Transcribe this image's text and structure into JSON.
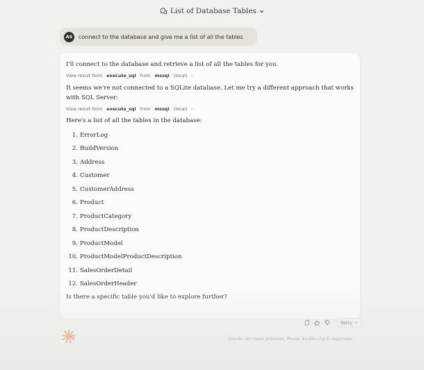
{
  "header": {
    "title": "List of Database Tables"
  },
  "user_message": {
    "initials": "AS",
    "text": "connect to the database and give me a list of all the tables"
  },
  "assistant": {
    "intro": "I'll connect to the database and retrieve a list of all the tables for you.",
    "tool_calls": [
      {
        "prefix": "View result from",
        "tool": "execute_sql",
        "from_label": "from",
        "server": "mssql",
        "scope": "(local)"
      },
      {
        "prefix": "View result from",
        "tool": "execute_sql",
        "from_label": "from",
        "server": "mssql",
        "scope": "(local)"
      }
    ],
    "middle": "It seems we're not connected to a SQLite database. Let me try a different approach that works with SQL Server:",
    "list_intro": "Here's a list of all the tables in the database:",
    "tables": [
      {
        "num": "1.",
        "name": "ErrorLog"
      },
      {
        "num": "2.",
        "name": "BuildVersion"
      },
      {
        "num": "3.",
        "name": "Address"
      },
      {
        "num": "4.",
        "name": "Customer"
      },
      {
        "num": "5.",
        "name": "CustomerAddress"
      },
      {
        "num": "6.",
        "name": "Product"
      },
      {
        "num": "7.",
        "name": "ProductCategory"
      },
      {
        "num": "8.",
        "name": "ProductDescription"
      },
      {
        "num": "9.",
        "name": "ProductModel"
      },
      {
        "num": "10.",
        "name": "ProductModelProductDescription"
      },
      {
        "num": "11.",
        "name": "SalesOrderDetail"
      },
      {
        "num": "12.",
        "name": "SalesOrderHeader"
      }
    ],
    "closing": "Is there a specific table you'd like to explore further?"
  },
  "actions": {
    "retry_label": "Retry"
  },
  "footer": {
    "disclaimer": "Claude can make mistakes. Please double-check responses."
  },
  "colors": {
    "accent": "#d97757",
    "background": "#f2f1ed",
    "user_bubble": "#e6e3dc",
    "avatar": "#2f2d29"
  },
  "icons": [
    "chat-bubbles-icon",
    "chevron-down-icon",
    "copy-icon",
    "thumbs-up-icon",
    "thumbs-down-icon",
    "claude-logo-icon"
  ]
}
